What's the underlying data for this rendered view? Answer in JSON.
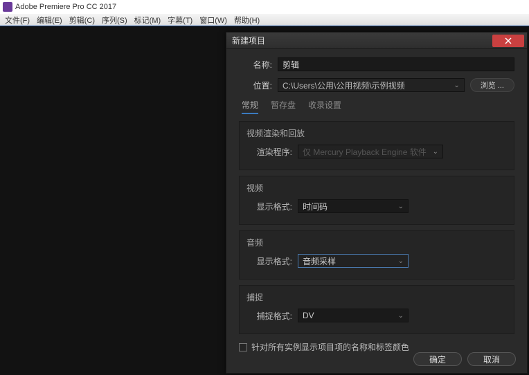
{
  "app": {
    "title": "Adobe Premiere Pro CC 2017"
  },
  "menu": {
    "items": [
      "文件(F)",
      "编辑(E)",
      "剪辑(C)",
      "序列(S)",
      "标记(M)",
      "字幕(T)",
      "窗口(W)",
      "帮助(H)"
    ]
  },
  "dialog": {
    "title": "新建项目",
    "name_label": "名称:",
    "name_value": "剪辑",
    "location_label": "位置:",
    "location_value": "C:\\Users\\公用\\公用视频\\示例视频",
    "browse_label": "浏览 ...",
    "tabs": {
      "general": "常规",
      "scratch": "暂存盘",
      "ingest": "收录设置"
    },
    "section_render": {
      "title": "视频渲染和回放",
      "renderer_label": "渲染程序:",
      "renderer_value": "仅 Mercury Playback Engine 软件"
    },
    "section_video": {
      "title": "视频",
      "format_label": "显示格式:",
      "format_value": "时间码"
    },
    "section_audio": {
      "title": "音频",
      "format_label": "显示格式:",
      "format_value": "音频采样"
    },
    "section_capture": {
      "title": "捕捉",
      "format_label": "捕捉格式:",
      "format_value": "DV"
    },
    "checkbox_label": "针对所有实例显示项目项的名称和标签颜色",
    "ok_label": "确定",
    "cancel_label": "取消"
  }
}
